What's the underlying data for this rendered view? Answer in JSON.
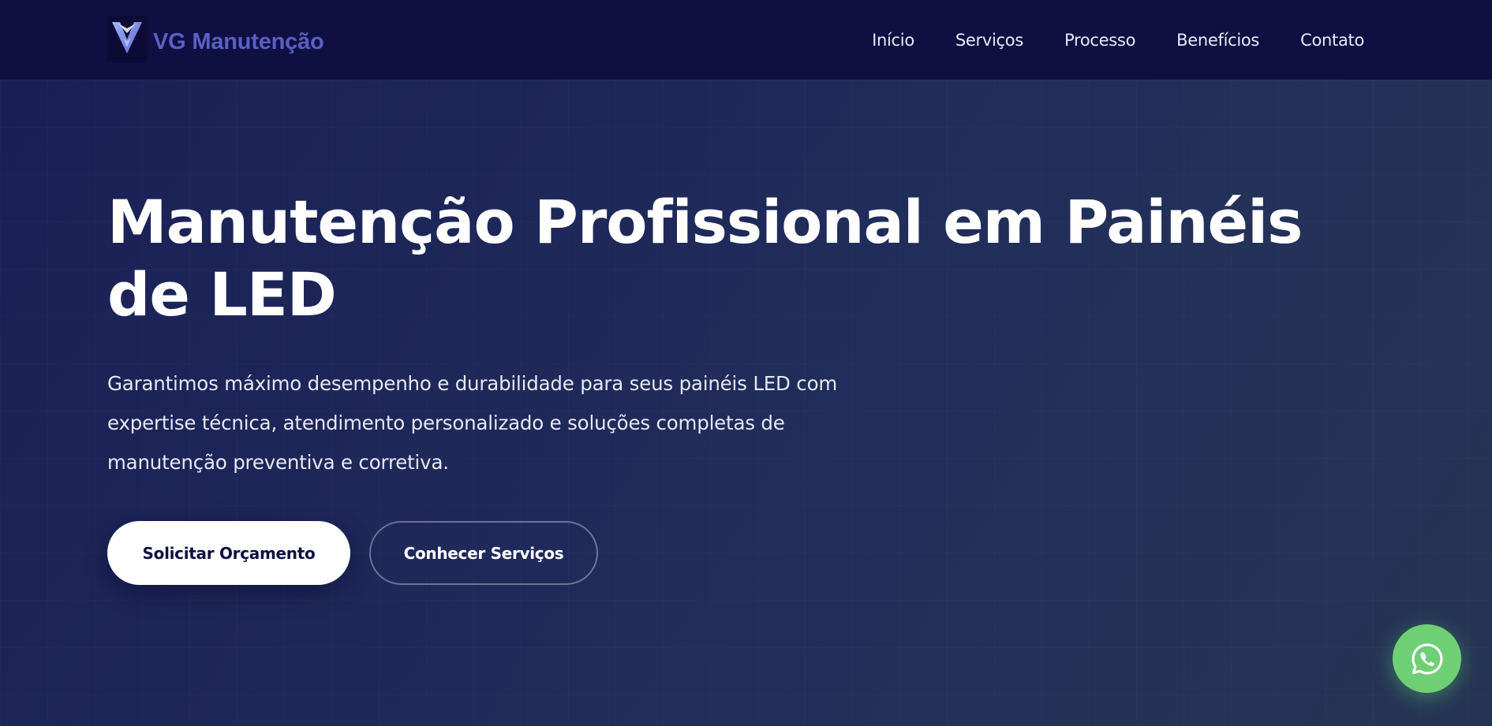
{
  "brand": {
    "name": "VG Manutenção",
    "logo_icon": "v-shield-logo-icon",
    "color": "#5a5fc4"
  },
  "nav": {
    "items": [
      "Início",
      "Serviços",
      "Processo",
      "Benefícios",
      "Contato"
    ]
  },
  "hero": {
    "title": "Manutenção Profissional em Painéis de LED",
    "subtitle": "Garantimos máximo desempenho e durabilidade para seus painéis LED com expertise técnica, atendimento personalizado e soluções completas de manutenção preventiva e corretiva.",
    "primary_cta": "Solicitar Orçamento",
    "secondary_cta": "Conhecer Serviços"
  },
  "floating": {
    "whatsapp_icon": "whatsapp-icon",
    "color": "#6fcf75"
  },
  "colors": {
    "header_bg": "#100f42",
    "hero_bg": "#1f2a5a",
    "text": "#ffffff"
  }
}
